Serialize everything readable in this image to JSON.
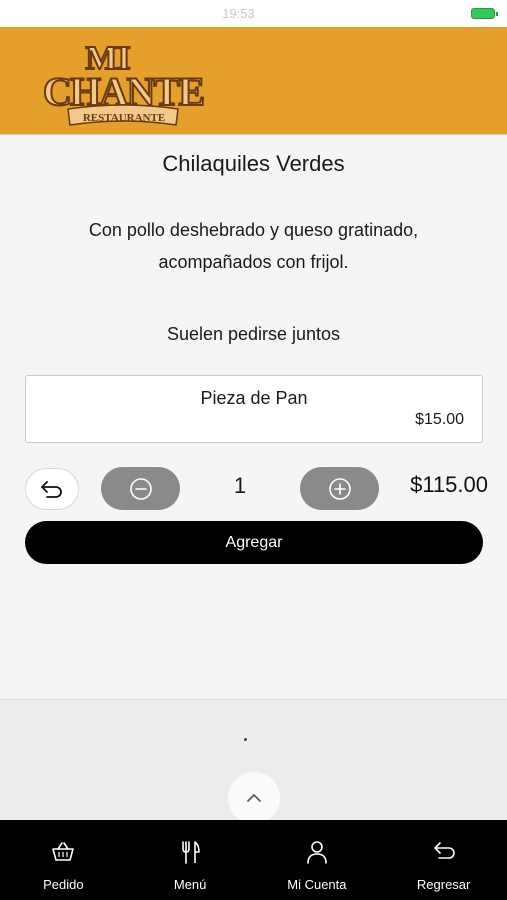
{
  "status_bar": {
    "carrier": "",
    "time": "19:53",
    "battery": ""
  },
  "brand": {
    "logo_line1": "MI",
    "logo_line2": "CHANTE",
    "logo_ribbon": "RESTAURANTE",
    "header_color": "#e59f2d"
  },
  "product": {
    "title": "Chilaquiles Verdes",
    "description_line1": "Con pollo deshebrado y queso gratinado,",
    "description_line2": "acompañados con frijol."
  },
  "suggestions": {
    "section_title": "Suelen pedirse juntos",
    "items": [
      {
        "name": "Pieza de Pan",
        "price": "$15.00"
      }
    ]
  },
  "order": {
    "quantity": "1",
    "total": "$115.00",
    "add_label": "Agregar",
    "back_icon": "undo-arrow-icon",
    "minus_icon": "minus-circle-icon",
    "plus_icon": "plus-circle-icon"
  },
  "lower": {
    "dot": "."
  },
  "tabbar": {
    "items": [
      {
        "label": "Pedido",
        "icon": "basket-icon"
      },
      {
        "label": "Menú",
        "icon": "fork-knife-icon"
      },
      {
        "label": "Mi Cuenta",
        "icon": "user-icon"
      },
      {
        "label": "Regresar",
        "icon": "back-arrow-icon"
      }
    ]
  }
}
